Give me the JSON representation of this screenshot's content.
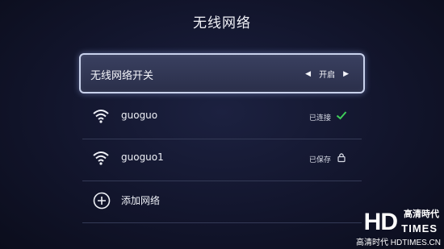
{
  "header": {
    "title": "无线网络"
  },
  "toggle": {
    "label": "无线网络开关",
    "value": "开启"
  },
  "networks": [
    {
      "name": "guoguo",
      "status": "已连接",
      "status_icon": "check-icon"
    },
    {
      "name": "guoguo1",
      "status": "已保存",
      "status_icon": "lock-icon"
    }
  ],
  "add_network": {
    "label": "添加网络"
  },
  "watermark": {
    "logo": "HD",
    "chinese": "高清時代",
    "times": "TIMES",
    "url": "高清时代 HDTIMES.CN"
  },
  "colors": {
    "check": "#3fcf5a",
    "focus_border": "#c9d2ec"
  }
}
